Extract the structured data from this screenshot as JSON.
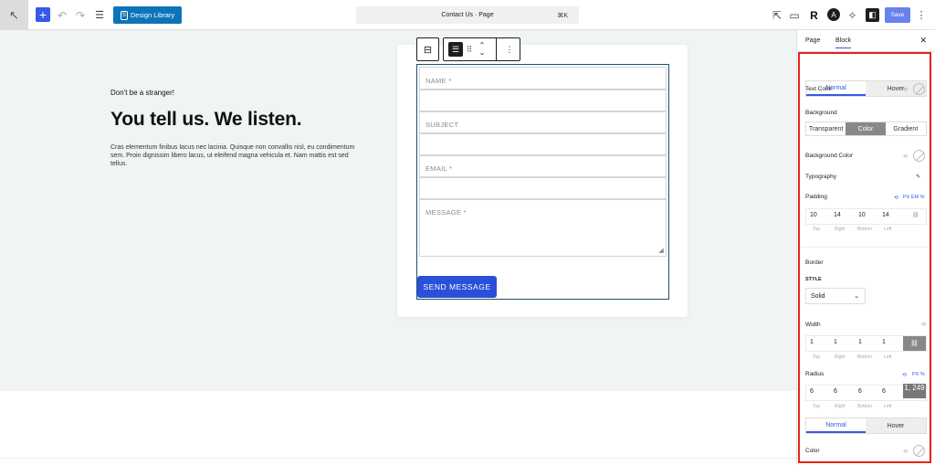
{
  "topbar": {
    "design_library_label": "Design Library",
    "design_library_badge": "S",
    "command_title": "Contact Us · Page",
    "command_shortcut": "⌘K",
    "save_label": "Save"
  },
  "content": {
    "tagline": "Don't be a stranger!",
    "headline": "You tell us. We listen.",
    "paragraph": "Cras elementum finibus lacus nec lacinia. Quisque non convallis nisl, eu condimentum sem. Proin dignissim libero lacus, ut eleifend magna vehicula et. Nam mattis est sed tellus."
  },
  "form": {
    "name_placeholder": "NAME *",
    "subject_placeholder": "SUBJECT",
    "email_placeholder": "EMAIL *",
    "message_placeholder": "MESSAGE *",
    "submit_label": "SEND MESSAGE"
  },
  "panel": {
    "tab_page": "Page",
    "tab_block": "Block",
    "state_normal": "Normal",
    "state_hover": "Hover",
    "text_color_label": "Text Color",
    "background_label": "Background",
    "bg_options": [
      "Transparent",
      "Color",
      "Gradient"
    ],
    "bg_selected": "Color",
    "background_color_label": "Background Color",
    "typography_label": "Typography",
    "padding_label": "Padding",
    "units": "PX EM %",
    "padding_values": [
      "10",
      "14",
      "10",
      "14"
    ],
    "side_labels": [
      "Top",
      "Right",
      "Bottom",
      "Left"
    ],
    "border_label": "Border",
    "style_label": "STYLE",
    "style_value": "Solid",
    "width_label": "Width",
    "width_values": [
      "1",
      "1",
      "1",
      "1"
    ],
    "radius_label": "Radius",
    "radius_units": "PX %",
    "radius_values": [
      "6",
      "6",
      "6",
      "6"
    ],
    "radius_overlay": "1, 249",
    "state_normal_2": "Normal",
    "state_hover_2": "Hover",
    "color_label": "Color"
  },
  "colors": {
    "accent": "#3858e9",
    "design_library": "#0e73b9",
    "highlight_box": "#e8221b",
    "canvas_bg": "#f1f4f5"
  }
}
